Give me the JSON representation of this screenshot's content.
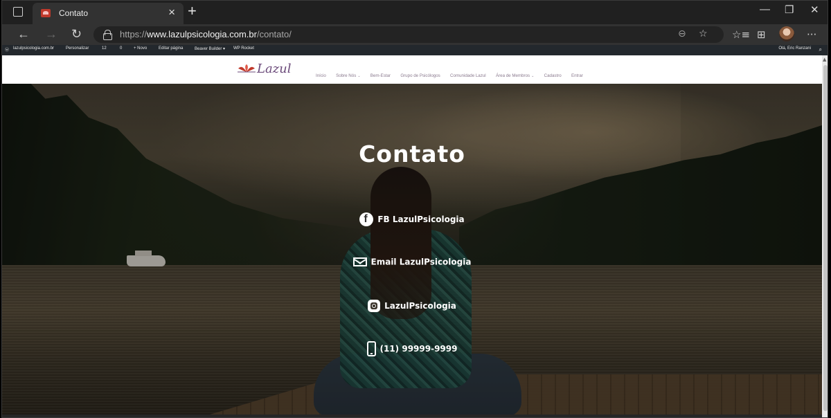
{
  "browser": {
    "tab_title": "Contato",
    "tab_close": "×",
    "new_tab": "+",
    "url_prefix": "https://",
    "url_domain": "www.lazulpsicologia.com.br",
    "url_path": "/contato/",
    "window_minimize": "—",
    "window_restore": "❐",
    "window_close": "✕",
    "back": "←",
    "forward": "→",
    "reload": "↻",
    "zoom_icon": "⊖",
    "favorite_add": "☆",
    "favorites": "☆≡",
    "collections": "⊞",
    "more": "···"
  },
  "adminbar": {
    "wp_logo": "ⓦ",
    "site": "lazulpsicologia.com.br",
    "customize": "Personalizar",
    "updates": "12",
    "comments": "0",
    "new": "+ Novo",
    "edit_page": "Editar página",
    "beaver": "Beaver Builder ▾",
    "wp_rocket": "WP Rocket",
    "greeting": "Olá, Eric Ranzani",
    "search": "⌕"
  },
  "header": {
    "logo_text": "Lazul",
    "menu": [
      {
        "label": "Início",
        "caret": ""
      },
      {
        "label": "Sobre Nós",
        "caret": "⌄"
      },
      {
        "label": "Bem-Estar",
        "caret": ""
      },
      {
        "label": "Grupo de Psicólogos",
        "caret": ""
      },
      {
        "label": "Comunidade Lazul",
        "caret": ""
      },
      {
        "label": "Área de Membros",
        "caret": "⌄"
      },
      {
        "label": "Cadastro",
        "caret": ""
      },
      {
        "label": "Entrar",
        "caret": ""
      }
    ]
  },
  "hero": {
    "title": "Contato",
    "contacts": {
      "facebook": "FB LazulPsicologia",
      "email": "Email LazulPsicologia",
      "instagram": "LazulPsicologia",
      "phone": "(11) 99999-9999"
    }
  },
  "colors": {
    "browser_bg": "#202020",
    "toolbar_bg": "#323232",
    "adminbar_bg": "#23282d",
    "menu_text": "#8a7a8e",
    "logo_text": "#6b4a7a",
    "hero_text": "#ffffff"
  },
  "icons": {
    "facebook": "facebook-icon",
    "email": "envelope-icon",
    "instagram": "instagram-icon",
    "phone": "smartphone-icon",
    "lock": "lock-icon"
  }
}
